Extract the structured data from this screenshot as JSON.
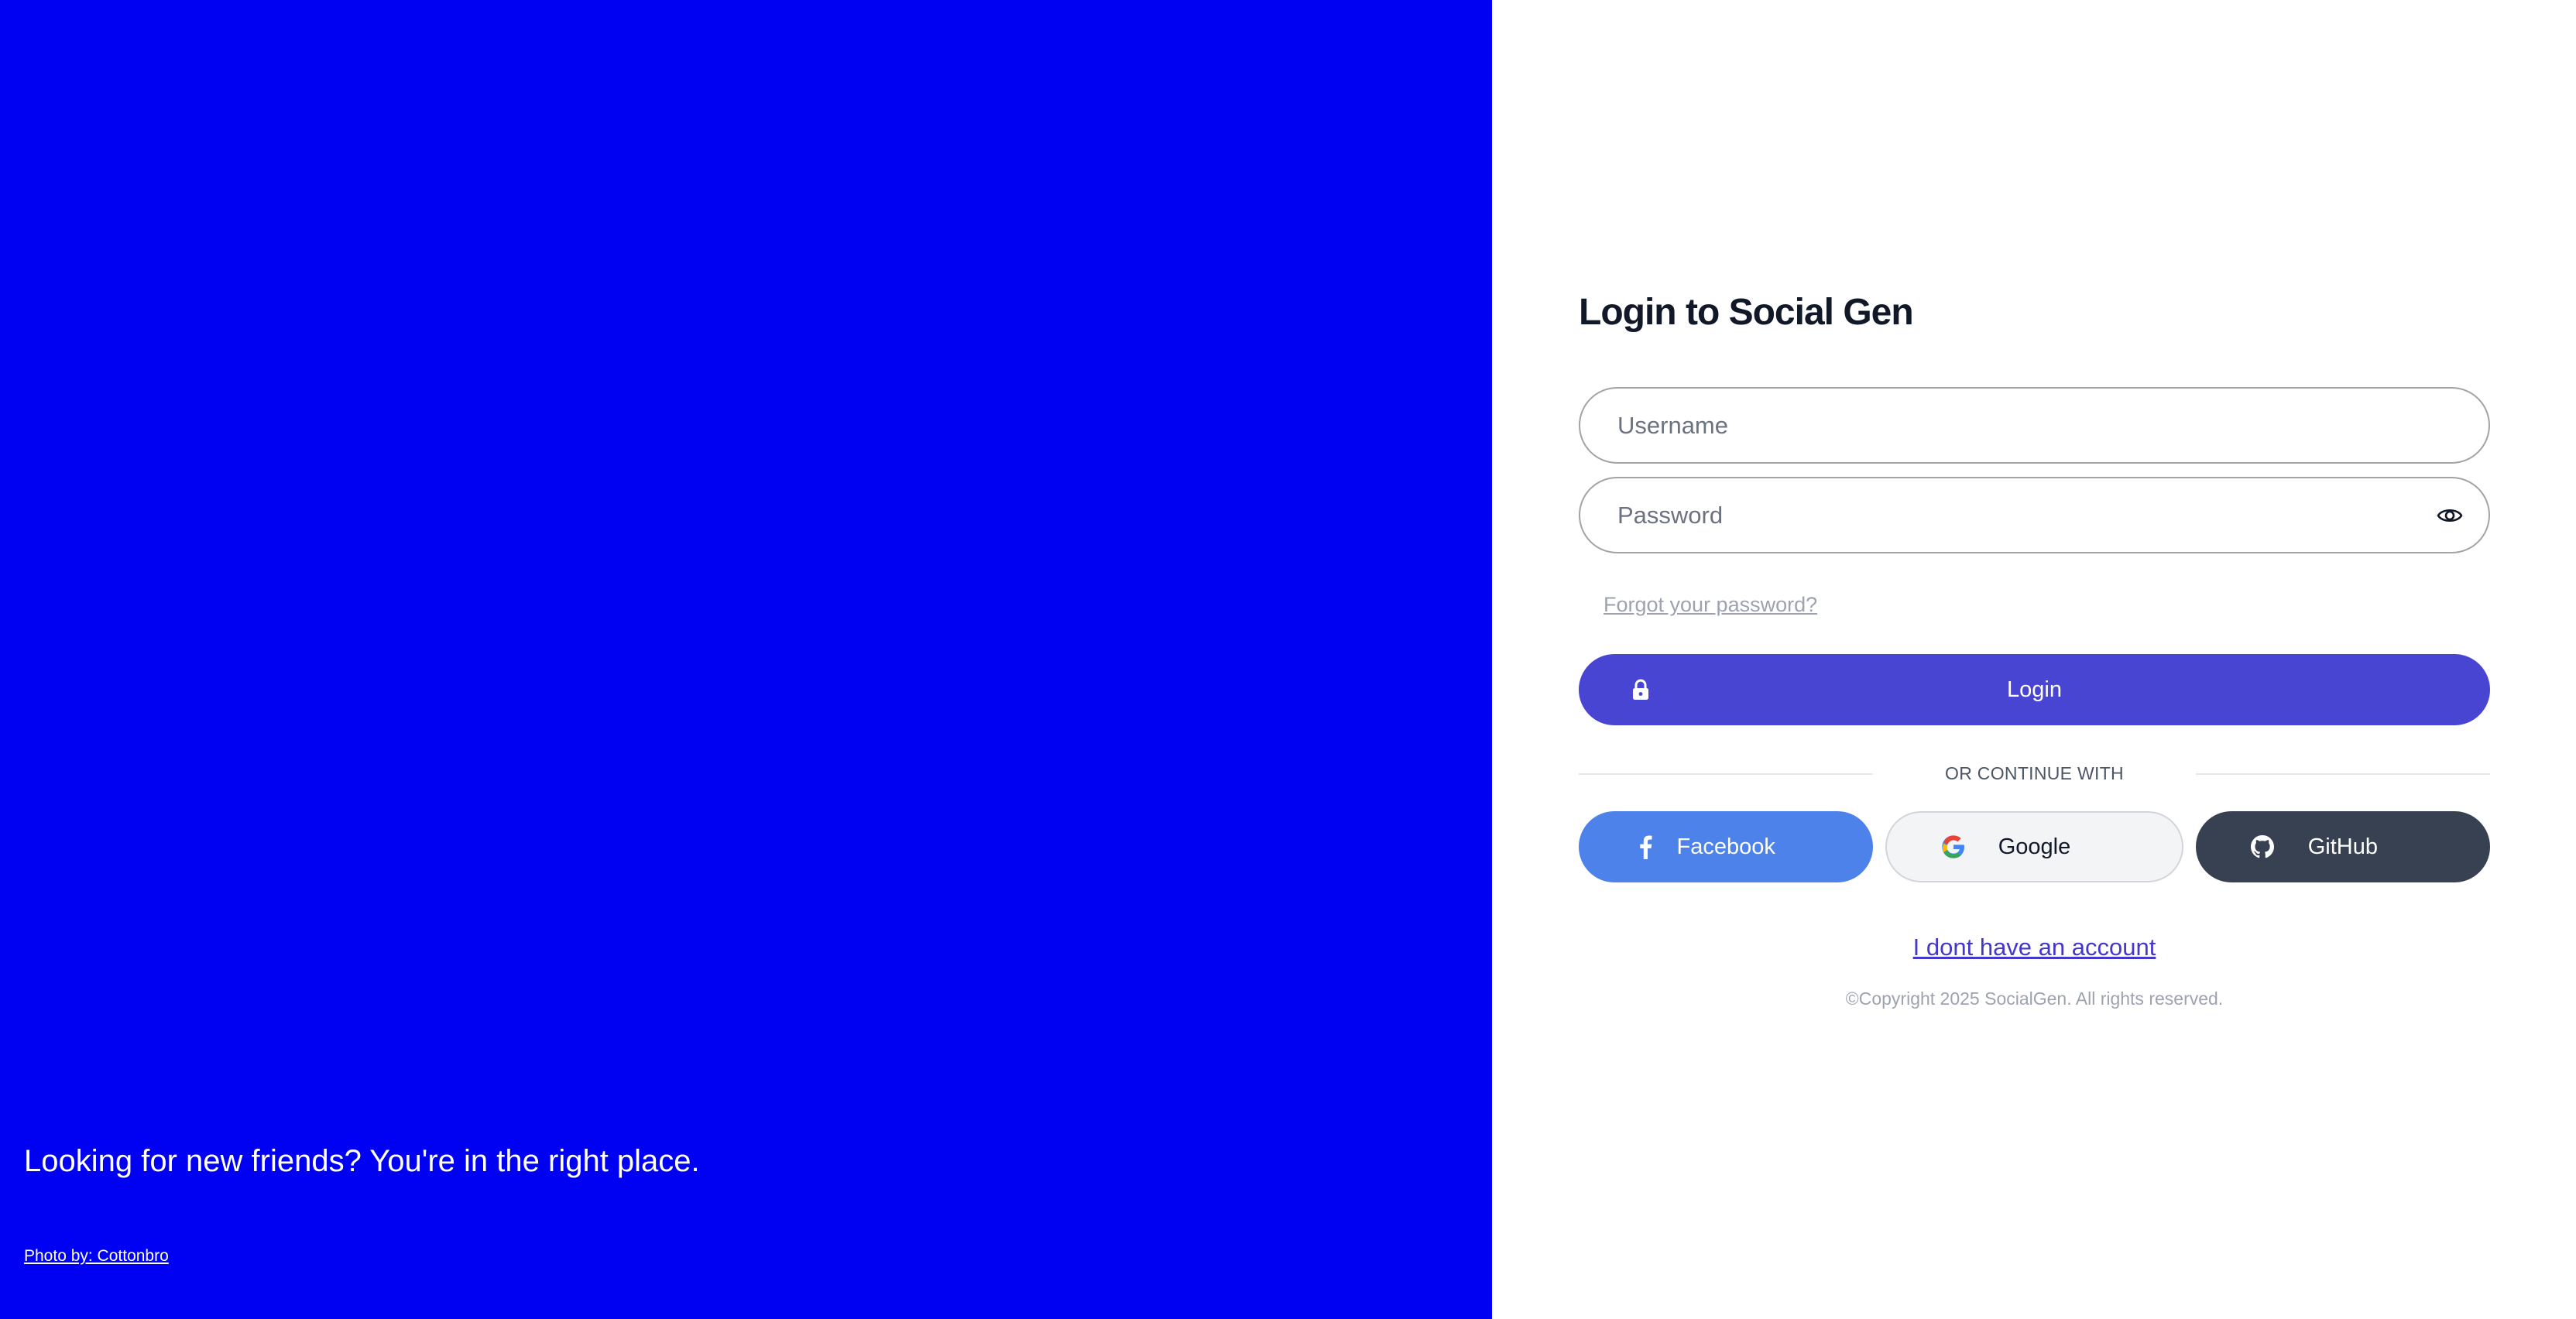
{
  "hero": {
    "background_color": "#0000f2",
    "tagline": "Looking for new friends? You're in the right place.",
    "photo_credit": "Photo by: Cottonbro"
  },
  "auth": {
    "title": "Login to Social Gen",
    "username_placeholder": "Username",
    "password_placeholder": "Password",
    "forgot_password": "Forgot your password?",
    "login_label": "Login",
    "divider_text": "OR CONTINUE WITH",
    "social": {
      "facebook_label": "Facebook",
      "google_label": "Google",
      "github_label": "GitHub"
    },
    "no_account": "I dont have an account",
    "copyright": "©Copyright 2025 SocialGen. All rights reserved.",
    "colors": {
      "primary": "#4845d2",
      "facebook": "#4c82ea",
      "github": "#374151",
      "link": "#4338ca"
    },
    "icons": {
      "password_toggle": "eye-icon",
      "login": "lock-icon",
      "facebook": "facebook-icon",
      "google": "google-icon",
      "github": "github-icon"
    }
  }
}
